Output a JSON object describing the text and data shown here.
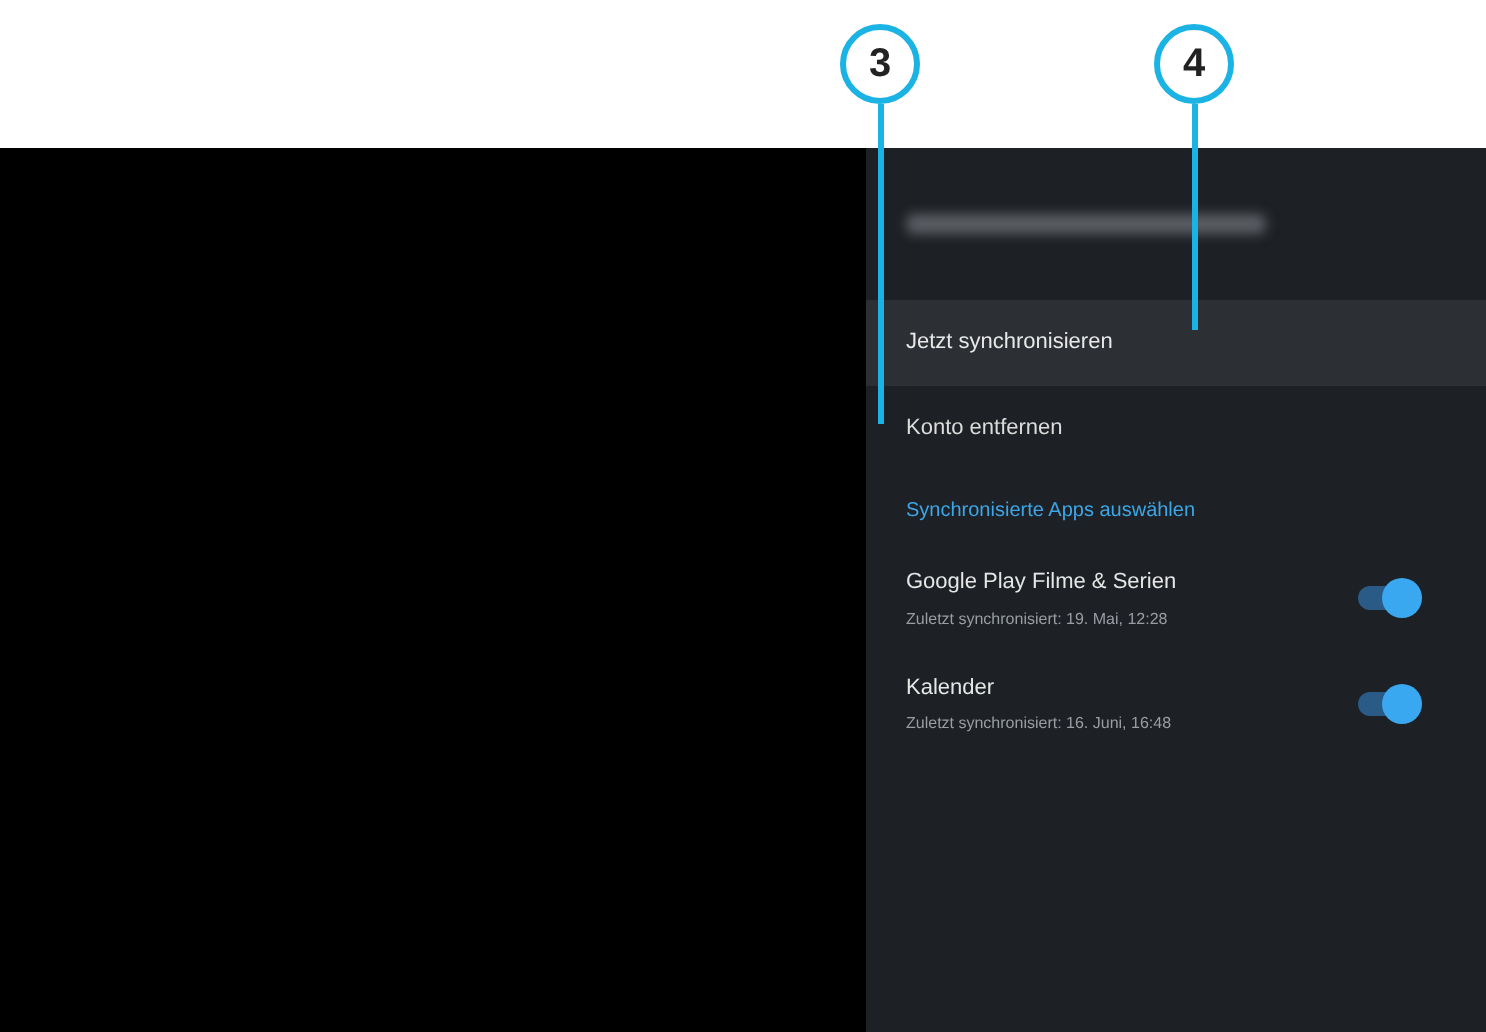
{
  "callouts": [
    {
      "label": "3"
    },
    {
      "label": "4"
    }
  ],
  "panel": {
    "actions": [
      {
        "label": "Jetzt synchronisieren",
        "selected": true
      },
      {
        "label": "Konto entfernen",
        "selected": false
      }
    ],
    "section_header": "Synchronisierte Apps auswählen",
    "apps": [
      {
        "name": "Google Play Filme & Serien",
        "subtitle": "Zuletzt synchronisiert: 19. Mai, 12:28",
        "on": true
      },
      {
        "name": "Kalender",
        "subtitle": "Zuletzt synchronisiert: 16. Juni, 16:48",
        "on": true
      }
    ]
  }
}
